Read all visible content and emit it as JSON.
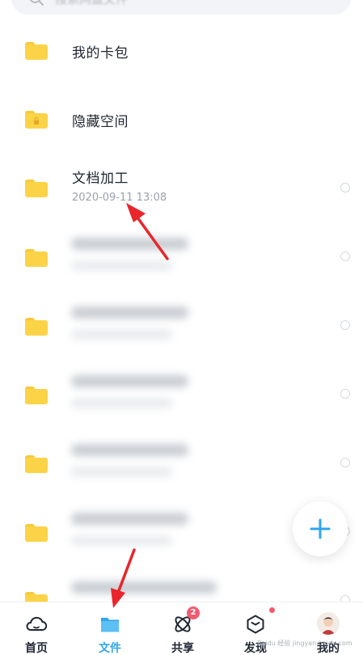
{
  "search": {
    "placeholder": "搜索网盘文件"
  },
  "files": [
    {
      "name": "我的卡包",
      "date": "",
      "type": "folder"
    },
    {
      "name": "隐藏空间",
      "date": "",
      "type": "locked-folder"
    },
    {
      "name": "文档加工",
      "date": "2020-09-11  13:08",
      "type": "folder"
    }
  ],
  "blurred_rows": 6,
  "fab": {
    "icon": "plus-icon"
  },
  "bottom_nav": {
    "items": [
      {
        "label": "首页",
        "icon": "cloud-home-icon",
        "active": false
      },
      {
        "label": "文件",
        "icon": "folder-icon",
        "active": true
      },
      {
        "label": "共享",
        "icon": "share-orbit-icon",
        "active": false,
        "badge": "2"
      },
      {
        "label": "发现",
        "icon": "discover-cube-icon",
        "active": false,
        "dot": true
      },
      {
        "label": "我的",
        "icon": "avatar-icon",
        "active": false
      }
    ]
  },
  "colors": {
    "accent": "#2fa6ee",
    "folder": "#fbd347",
    "badge": "#f25a6f",
    "annotation_arrow": "#e8262b"
  },
  "watermark": "Baidu 经验 jingyan.baidu.com"
}
